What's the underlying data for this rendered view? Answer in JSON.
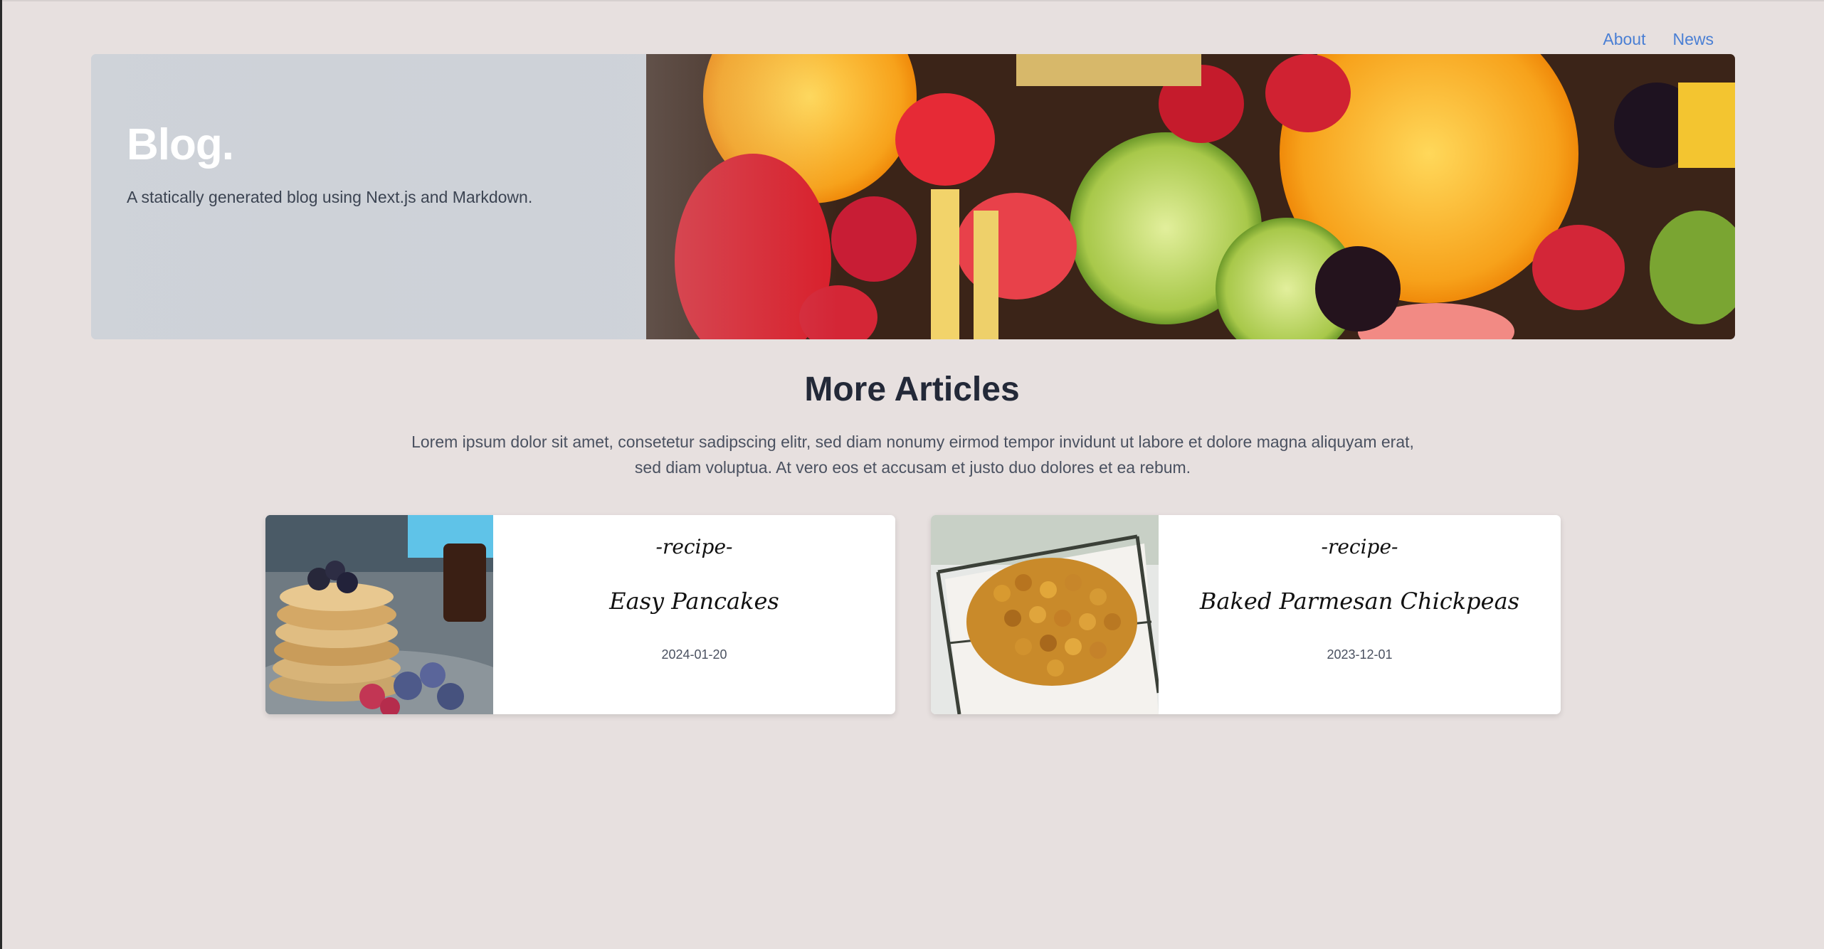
{
  "nav": {
    "items": [
      {
        "label": "About"
      },
      {
        "label": "News"
      }
    ]
  },
  "hero": {
    "title": "Blog.",
    "subtitle": "A statically generated blog using Next.js and Markdown.",
    "image_icon": "fruit-photo"
  },
  "section": {
    "title": "More Articles",
    "description": "Lorem ipsum dolor sit amet, consetetur sadipscing elitr, sed diam nonumy eirmod tempor invidunt ut labore et dolore magna aliquyam erat, sed diam voluptua. At vero eos et accusam et justo duo dolores et ea rebum."
  },
  "articles": [
    {
      "tag": "-recipe-",
      "title": "Easy Pancakes",
      "date": "2024-01-20",
      "image_icon": "pancakes-photo"
    },
    {
      "tag": "-recipe-",
      "title": "Baked Parmesan Chickpeas",
      "date": "2023-12-01",
      "image_icon": "chickpeas-photo"
    }
  ],
  "colors": {
    "background": "#e7e0df",
    "link": "#4a7fd4",
    "heading": "#232938",
    "text": "#4a5160"
  }
}
